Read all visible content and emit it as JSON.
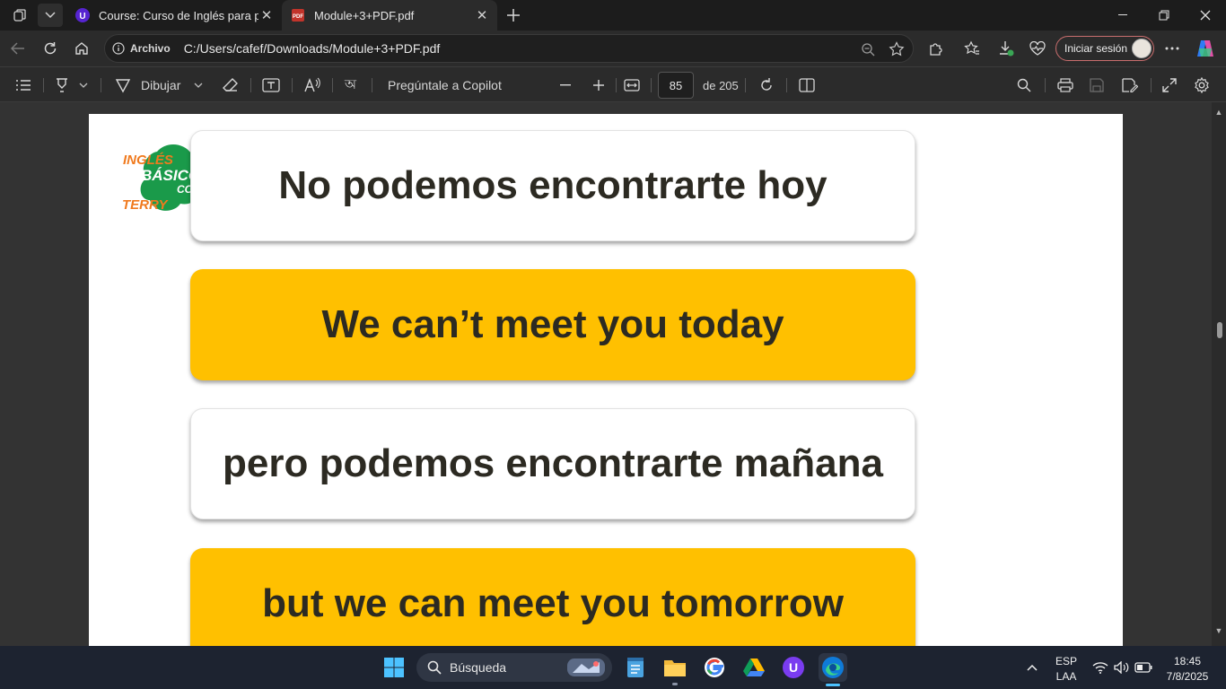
{
  "browser": {
    "tabs": [
      {
        "title": "Course: Curso de Inglés para prin",
        "active": false
      },
      {
        "title": "Module+3+PDF.pdf",
        "active": true
      }
    ],
    "address": {
      "info_label": "Archivo",
      "url": "C:/Users/cafef/Downloads/Module+3+PDF.pdf"
    },
    "signin_label": "Iniciar sesión"
  },
  "pdf_toolbar": {
    "draw_label": "Dibujar",
    "copilot_label": "Pregúntale a Copilot",
    "page_current": "85",
    "page_total_label": "de 205"
  },
  "document": {
    "logo": {
      "line1": "INGLÉS",
      "line2": "BÁSICO",
      "line3": "TERRY",
      "suffix": "CO"
    },
    "cards": [
      {
        "text": "No podemos encontrarte hoy",
        "style": "white"
      },
      {
        "text": "We can’t meet you today",
        "style": "yellow"
      },
      {
        "text": "pero podemos encontrarte mañana",
        "style": "white"
      },
      {
        "text": "but we can meet you tomorrow",
        "style": "yellow"
      }
    ]
  },
  "taskbar": {
    "search_placeholder": "Búsqueda",
    "language": "ESP",
    "keyboard": "LAA",
    "time": "18:45",
    "date": "7/8/2025"
  },
  "colors": {
    "card_yellow": "#ffc000",
    "card_text": "#2c2a22",
    "logo_green": "#1a9a4a",
    "logo_orange": "#f07a1e"
  }
}
